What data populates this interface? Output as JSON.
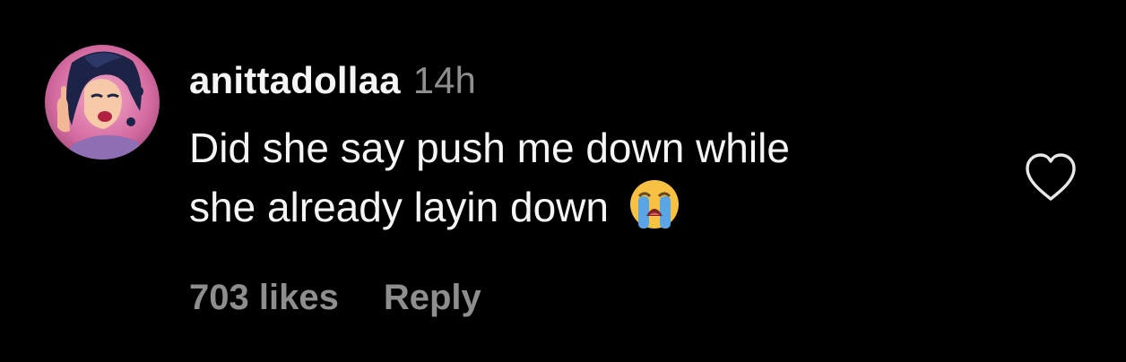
{
  "comment": {
    "username": "anittadollaa",
    "timestamp": "14h",
    "text_lines": [
      "Did she say push me down while",
      "she already layin down"
    ],
    "emoji": "loudly-crying-face-icon",
    "likes": "703 likes",
    "reply_label": "Reply",
    "like_icon": "heart-outline-icon"
  },
  "colors": {
    "background": "#000000",
    "primary_text": "#f5f5f5",
    "secondary_text": "#8e8e8e"
  }
}
